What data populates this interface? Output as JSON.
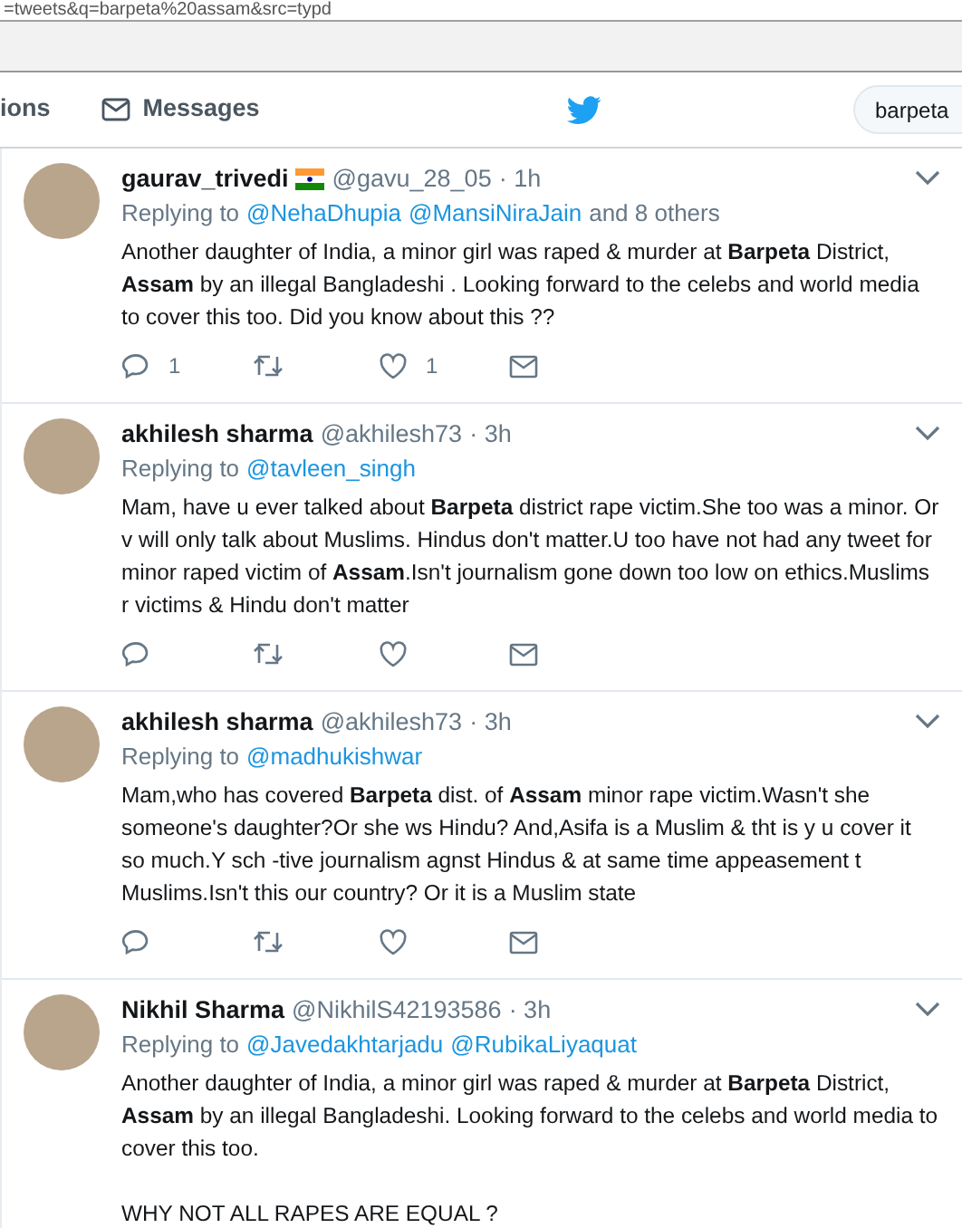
{
  "address_bar": {
    "url": "=tweets&q=barpeta%20assam&src=typd"
  },
  "nav": {
    "items": [
      {
        "label": "ions",
        "kind": "text"
      },
      {
        "label": "Messages",
        "kind": "messages"
      }
    ],
    "search": {
      "value": "barpeta"
    }
  },
  "tweets": [
    {
      "name": "gaurav_trivedi",
      "flag": true,
      "handle": "@gavu_28_05",
      "time": "· 1h",
      "replying_prefix": "Replying to",
      "mentions": [
        "@NehaDhupia",
        "@MansiNiraJain"
      ],
      "replying_suffix": "and 8 others",
      "body": [
        "Another daughter of India, a minor girl was raped  & murder at **Barpeta** District, **Assam** by an illegal Bangladeshi . Looking forward to the celebs and world media to cover this too. Did you know about this ??"
      ],
      "actions": {
        "show": true,
        "replies": "1",
        "likes": "1"
      }
    },
    {
      "name": "akhilesh sharma",
      "flag": false,
      "handle": "@akhilesh73",
      "time": "· 3h",
      "replying_prefix": "Replying to",
      "mentions": [
        "@tavleen_singh"
      ],
      "body": [
        "Mam, have u ever talked about **Barpeta** district rape victim.She too was a minor. Or v will only talk about Muslims. Hindus don't matter.U too have not had any tweet for minor raped victim of **Assam**.Isn't journalism gone down too low on ethics.Muslims r victims & Hindu don't matter"
      ],
      "actions": {
        "show": true
      }
    },
    {
      "name": "akhilesh sharma",
      "flag": false,
      "handle": "@akhilesh73",
      "time": "· 3h",
      "replying_prefix": "Replying to",
      "mentions": [
        "@madhukishwar"
      ],
      "body": [
        "Mam,who has covered **Barpeta** dist. of **Assam** minor rape victim.Wasn't she someone's daughter?Or she ws Hindu? And,Asifa is a Muslim & tht is y u cover it so much.Y sch -tive journalism agnst Hindus & at same time appeasement t Muslims.Isn't this our country? Or it is a Muslim state"
      ],
      "actions": {
        "show": true
      }
    },
    {
      "name": "Nikhil Sharma",
      "flag": false,
      "handle": "@NikhilS42193586",
      "time": "· 3h",
      "replying_prefix": "Replying to",
      "mentions": [
        "@Javedakhtarjadu",
        "@RubikaLiyaquat"
      ],
      "body": [
        "Another daughter of India, a minor girl was raped & murder at **Barpeta** District, **Assam** by an illegal Bangladeshi. Looking forward to the celebs and world media to cover this too.",
        "WHY NOT ALL RAPES ARE EQUAL ?"
      ],
      "actions": {
        "show": false
      }
    }
  ]
}
